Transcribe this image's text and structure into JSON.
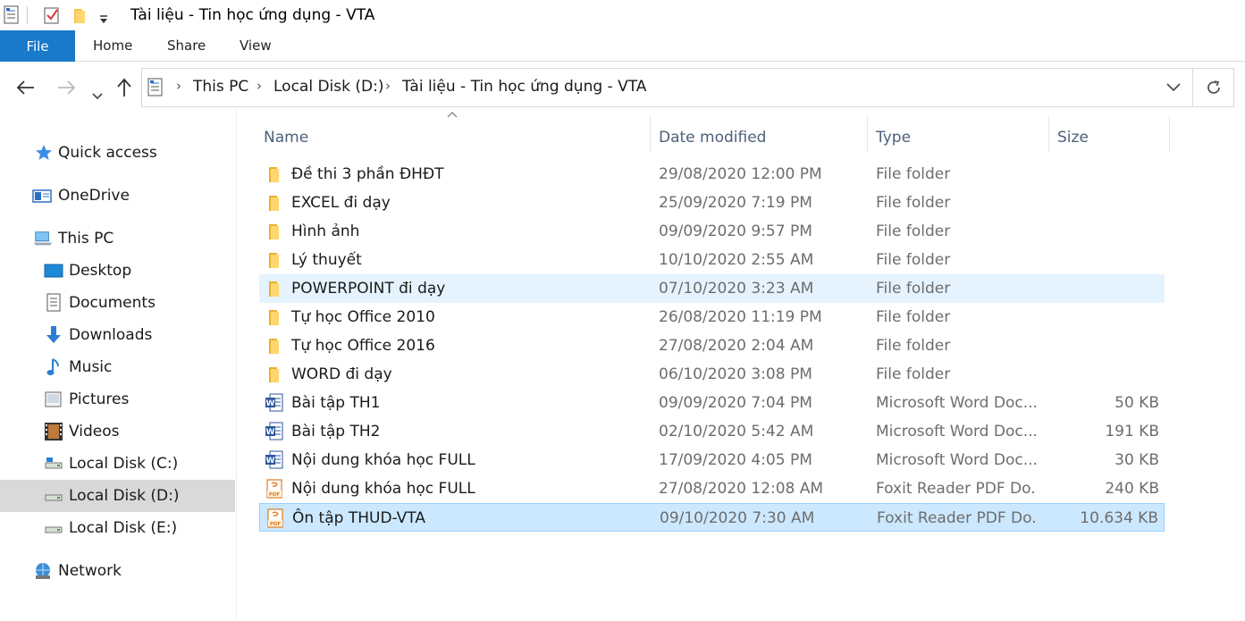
{
  "window": {
    "title": "Tài liệu - Tin học ứng dụng - VTA"
  },
  "ribbon": {
    "tabs": [
      "File",
      "Home",
      "Share",
      "View"
    ]
  },
  "address": {
    "crumbs": [
      "This PC",
      "Local Disk (D:)",
      "Tài liệu - Tin học ứng dụng - VTA"
    ]
  },
  "navpane": {
    "items": [
      {
        "label": "Quick access",
        "icon": "star-icon"
      },
      {
        "label": "OneDrive",
        "icon": "onedrive-icon"
      },
      {
        "label": "This PC",
        "icon": "computer-icon"
      },
      {
        "label": "Desktop",
        "icon": "desktop-icon"
      },
      {
        "label": "Documents",
        "icon": "documents-icon"
      },
      {
        "label": "Downloads",
        "icon": "downloads-icon"
      },
      {
        "label": "Music",
        "icon": "music-icon"
      },
      {
        "label": "Pictures",
        "icon": "pictures-icon"
      },
      {
        "label": "Videos",
        "icon": "videos-icon"
      },
      {
        "label": "Local Disk (C:)",
        "icon": "drive-icon"
      },
      {
        "label": "Local Disk (D:)",
        "icon": "drive-icon",
        "selected": true
      },
      {
        "label": "Local Disk (E:)",
        "icon": "drive-icon"
      },
      {
        "label": "Network",
        "icon": "network-icon"
      }
    ]
  },
  "columns": {
    "name": "Name",
    "date": "Date modified",
    "type": "Type",
    "size": "Size"
  },
  "files": [
    {
      "name": "Đề thi 3 phần ĐHĐT",
      "date": "29/08/2020 12:00 PM",
      "type": "File folder",
      "size": "",
      "kind": "folder"
    },
    {
      "name": "EXCEL đi dạy",
      "date": "25/09/2020 7:19 PM",
      "type": "File folder",
      "size": "",
      "kind": "folder"
    },
    {
      "name": "Hình ảnh",
      "date": "09/09/2020 9:57 PM",
      "type": "File folder",
      "size": "",
      "kind": "folder"
    },
    {
      "name": "Lý thuyết",
      "date": "10/10/2020 2:55 AM",
      "type": "File folder",
      "size": "",
      "kind": "folder"
    },
    {
      "name": "POWERPOINT đi dạy",
      "date": "07/10/2020 3:23 AM",
      "type": "File folder",
      "size": "",
      "kind": "folder",
      "state": "hover"
    },
    {
      "name": "Tự học Office 2010",
      "date": "26/08/2020 11:19 PM",
      "type": "File folder",
      "size": "",
      "kind": "folder"
    },
    {
      "name": "Tự học Office 2016",
      "date": "27/08/2020 2:04 AM",
      "type": "File folder",
      "size": "",
      "kind": "folder"
    },
    {
      "name": "WORD đi dạy",
      "date": "06/10/2020 3:08 PM",
      "type": "File folder",
      "size": "",
      "kind": "folder"
    },
    {
      "name": "Bài tập TH1",
      "date": "09/09/2020 7:04 PM",
      "type": "Microsoft Word Doc...",
      "size": "50 KB",
      "kind": "word"
    },
    {
      "name": "Bài tập TH2",
      "date": "02/10/2020 5:42 AM",
      "type": "Microsoft Word Doc...",
      "size": "191 KB",
      "kind": "word"
    },
    {
      "name": "Nội dung khóa học FULL",
      "date": "17/09/2020 4:05 PM",
      "type": "Microsoft Word Doc...",
      "size": "30 KB",
      "kind": "word"
    },
    {
      "name": "Nội dung khóa học FULL",
      "date": "27/08/2020 12:08 AM",
      "type": "Foxit Reader PDF Do...",
      "size": "240 KB",
      "kind": "pdf"
    },
    {
      "name": "Ôn tập THUD-VTA",
      "date": "09/10/2020 7:30 AM",
      "type": "Foxit Reader PDF Do...",
      "size": "10.634 KB",
      "kind": "pdf",
      "state": "selected"
    }
  ],
  "colors": {
    "file_tab": "#1979ca",
    "selected_row": "#cce8ff",
    "hover_row": "#e5f3ff",
    "folder": "#ffd76e"
  }
}
